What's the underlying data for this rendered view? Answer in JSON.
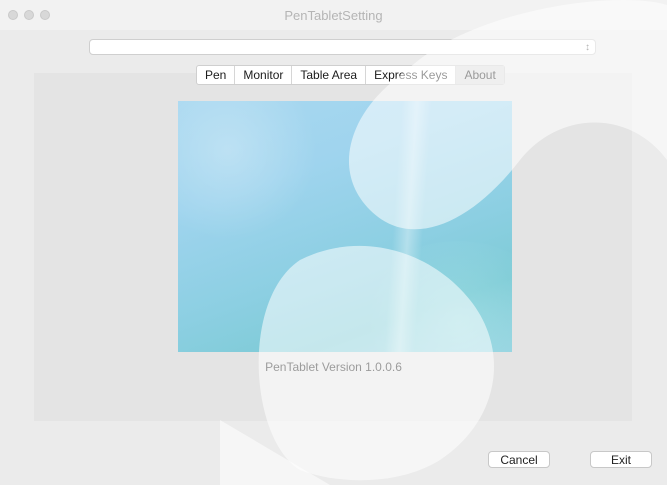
{
  "window": {
    "title": "PenTabletSetting"
  },
  "device_select": {
    "value": ""
  },
  "tabs": [
    {
      "label": "Pen",
      "active": false
    },
    {
      "label": "Monitor",
      "active": false
    },
    {
      "label": "Table Area",
      "active": false
    },
    {
      "label": "Express Keys",
      "active": false
    },
    {
      "label": "About",
      "active": true
    }
  ],
  "about": {
    "version_text": "PenTablet Version  1.0.0.6"
  },
  "footer": {
    "cancel_label": "Cancel",
    "exit_label": "Exit"
  },
  "colors": {
    "window_bg": "#ebebeb",
    "panel_bg": "#e4e4e4",
    "image_tint": "#9fd4ee"
  }
}
